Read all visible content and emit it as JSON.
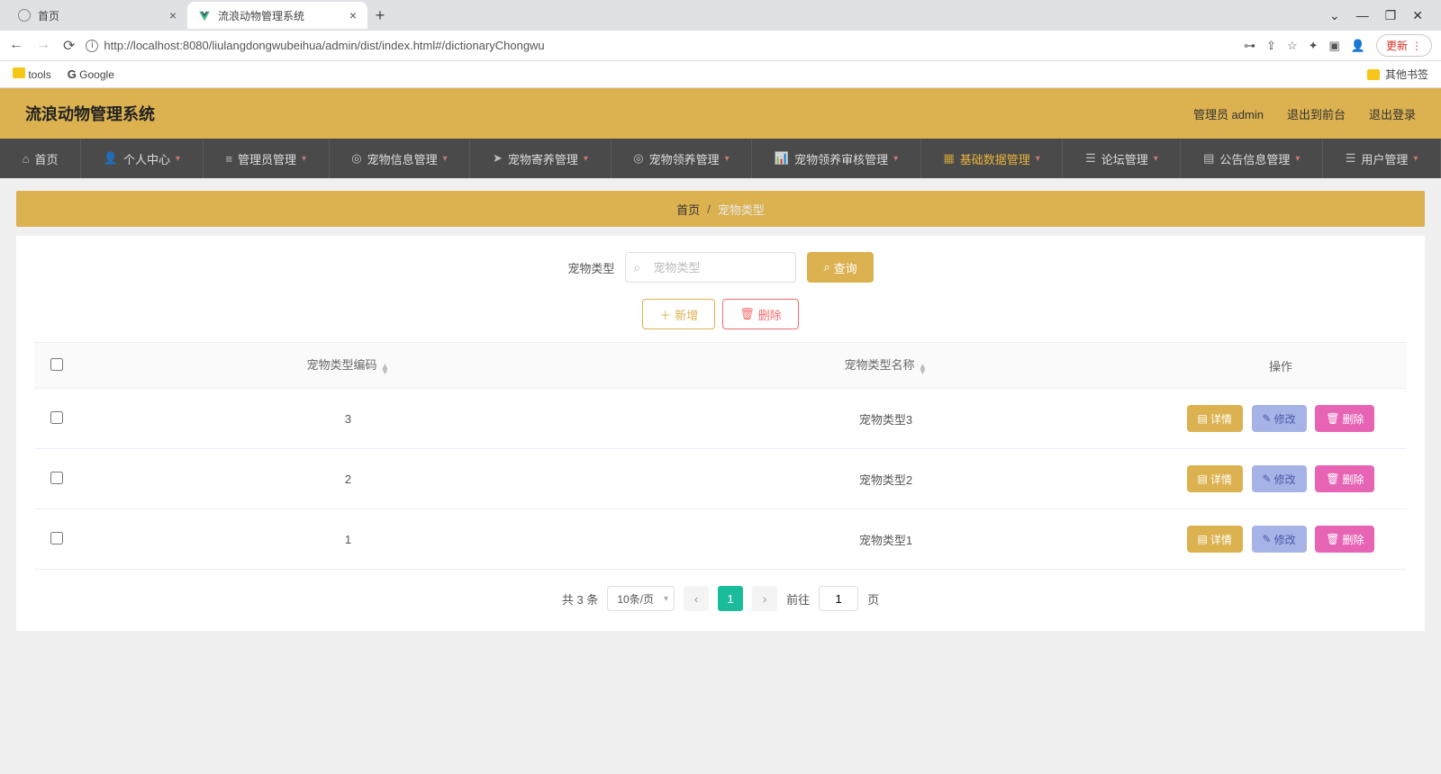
{
  "browser": {
    "tabs": [
      {
        "title": "首页"
      },
      {
        "title": "流浪动物管理系统"
      }
    ],
    "url": "http://localhost:8080/liulangdongwubeihua/admin/dist/index.html#/dictionaryChongwu",
    "update_label": "更新",
    "bookmarks": {
      "tools": "tools",
      "google": "Google",
      "other": "其他书签"
    }
  },
  "app": {
    "title": "流浪动物管理系统",
    "user_role": "管理员 admin",
    "exit_front": "退出到前台",
    "logout": "退出登录"
  },
  "nav": [
    {
      "label": "首页",
      "icon": "home"
    },
    {
      "label": "个人中心",
      "icon": "user"
    },
    {
      "label": "管理员管理",
      "icon": "list"
    },
    {
      "label": "宠物信息管理",
      "icon": "target"
    },
    {
      "label": "宠物寄养管理",
      "icon": "send"
    },
    {
      "label": "宠物领养管理",
      "icon": "target"
    },
    {
      "label": "宠物领养审核管理",
      "icon": "chart"
    },
    {
      "label": "基础数据管理",
      "icon": "grid",
      "active": true
    },
    {
      "label": "论坛管理",
      "icon": "bars"
    },
    {
      "label": "公告信息管理",
      "icon": "cal"
    },
    {
      "label": "用户管理",
      "icon": "users"
    }
  ],
  "breadcrumb": {
    "home": "首页",
    "current": "宠物类型"
  },
  "search": {
    "label": "宠物类型",
    "placeholder": "宠物类型",
    "btn": "查询"
  },
  "actions": {
    "add": "新增",
    "delete": "删除"
  },
  "table": {
    "col_code": "宠物类型编码",
    "col_name": "宠物类型名称",
    "col_ops": "操作",
    "btn_detail": "详情",
    "btn_edit": "修改",
    "btn_delete": "删除",
    "rows": [
      {
        "code": "3",
        "name": "宠物类型3"
      },
      {
        "code": "2",
        "name": "宠物类型2"
      },
      {
        "code": "1",
        "name": "宠物类型1"
      }
    ]
  },
  "pagination": {
    "total_text": "共 3 条",
    "page_size": "10条/页",
    "current": "1",
    "goto_prefix": "前往",
    "goto_suffix": "页",
    "goto_value": "1"
  }
}
